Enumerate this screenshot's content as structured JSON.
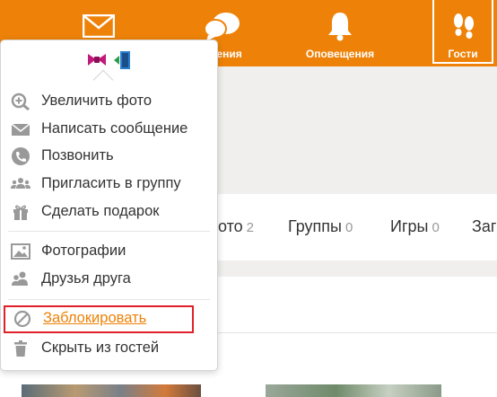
{
  "colors": {
    "brand_orange": "#ee8208",
    "icon_grey": "#999999",
    "block_highlight": "#e0202a"
  },
  "topbar": {
    "messages_icon": "envelope-icon",
    "discussions_label": "Обсуждения",
    "discussions_label_visible": "ждения",
    "discussions_icon": "speech-bubbles-icon",
    "notifications_label": "Оповещения",
    "notifications_icon": "bell-icon",
    "guests_label": "Гости",
    "guests_icon": "footprints-icon"
  },
  "profile_tabs": [
    {
      "label": "ото",
      "count": "2"
    },
    {
      "label": "Группы",
      "count": "0"
    },
    {
      "label": "Игры",
      "count": "0"
    },
    {
      "label": "Заг"
    }
  ],
  "popup": {
    "badges": [
      "ribbon-badge-icon",
      "door-badge-icon"
    ],
    "items": [
      {
        "label": "Увеличить фото",
        "icon": "zoom-in-icon"
      },
      {
        "label": "Написать сообщение",
        "icon": "envelope-icon"
      },
      {
        "label": "Позвонить",
        "icon": "phone-icon"
      },
      {
        "label": "Пригласить в группу",
        "icon": "group-icon"
      },
      {
        "label": "Сделать подарок",
        "icon": "gift-icon"
      },
      {
        "label": "Фотографии",
        "icon": "photos-icon"
      },
      {
        "label": "Друзья друга",
        "icon": "friends-icon"
      },
      {
        "label": "Заблокировать",
        "icon": "block-icon"
      },
      {
        "label": "Скрыть из гостей",
        "icon": "trash-icon"
      }
    ]
  }
}
